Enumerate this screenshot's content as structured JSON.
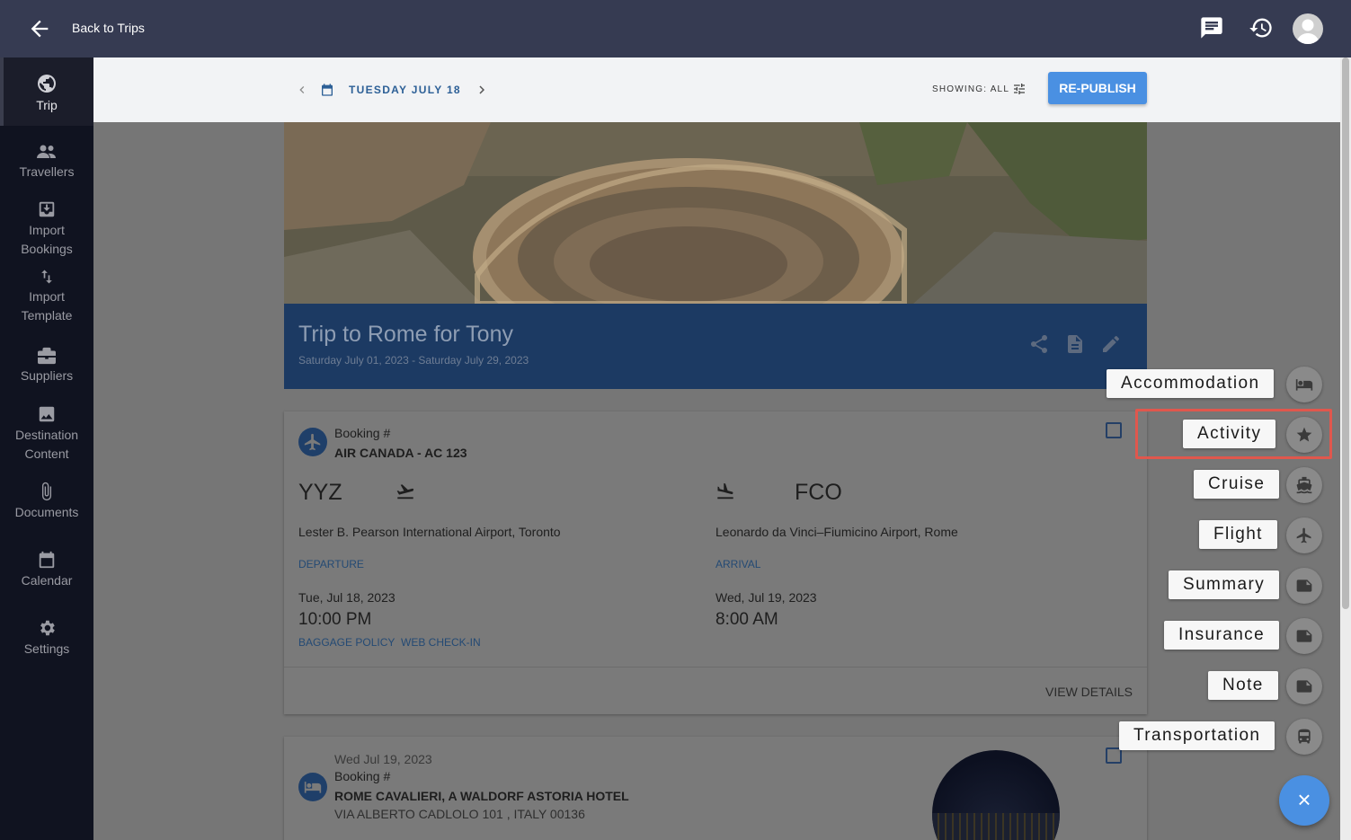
{
  "topbar": {
    "back_label": "Back to Trips",
    "icons": [
      "arrow-left-icon",
      "chat-icon",
      "history-icon",
      "avatar"
    ]
  },
  "sidebar": {
    "items": [
      {
        "label": "Trip",
        "icon": "globe-icon",
        "active": true
      },
      {
        "label": "Travellers",
        "icon": "people-icon"
      },
      {
        "label": "Import Bookings",
        "icon": "inbox-download-icon"
      },
      {
        "label": "Import Template",
        "icon": "swap-vertical-icon"
      },
      {
        "label": "Suppliers",
        "icon": "briefcase-icon"
      },
      {
        "label": "Destination Content",
        "icon": "image-icon"
      },
      {
        "label": "Documents",
        "icon": "paperclip-icon"
      },
      {
        "label": "Calendar",
        "icon": "calendar-icon"
      },
      {
        "label": "Settings",
        "icon": "gear-icon"
      }
    ]
  },
  "subheader": {
    "date": "TUESDAY JULY 18",
    "showing": "SHOWING: ALL",
    "republish": "RE-PUBLISH"
  },
  "trip": {
    "title": "Trip to Rome for Tony",
    "dates": "Saturday July 01, 2023 - Saturday July 29, 2023"
  },
  "flight_card": {
    "booking_label": "Booking #",
    "carrier": "AIR CANADA - AC 123",
    "from_code": "YYZ",
    "to_code": "FCO",
    "from_airport": "Lester B. Pearson International Airport, Toronto",
    "to_airport": "Leonardo da Vinci–Fiumicino Airport, Rome",
    "departure_label": "DEPARTURE",
    "arrival_label": "ARRIVAL",
    "dep_date": "Tue, Jul 18, 2023",
    "dep_time": "10:00 PM",
    "arr_date": "Wed, Jul 19, 2023",
    "arr_time": "8:00 AM",
    "baggage": "BAGGAGE POLICY",
    "checkin": "WEB CHECK-IN",
    "view_details": "VIEW DETAILS"
  },
  "hotel_card": {
    "date": "Wed Jul 19, 2023",
    "booking_label": "Booking #",
    "name": "ROME CAVALIERI, A WALDORF ASTORIA HOTEL",
    "address": "VIA ALBERTO CADLOLO 101 , ITALY 00136"
  },
  "fab_menu": {
    "items": [
      {
        "label": "Accommodation",
        "icon": "bed-icon"
      },
      {
        "label": "Activity",
        "icon": "star-icon"
      },
      {
        "label": "Cruise",
        "icon": "ship-icon"
      },
      {
        "label": "Flight",
        "icon": "airplane-icon"
      },
      {
        "label": "Summary",
        "icon": "note-icon"
      },
      {
        "label": "Insurance",
        "icon": "note-icon"
      },
      {
        "label": "Note",
        "icon": "note-icon"
      },
      {
        "label": "Transportation",
        "icon": "bus-icon"
      }
    ],
    "close": "×"
  },
  "colors": {
    "topbar": "#363b52",
    "sidebar": "#101320",
    "accent": "#4a90e2",
    "highlight": "#e0574d"
  }
}
